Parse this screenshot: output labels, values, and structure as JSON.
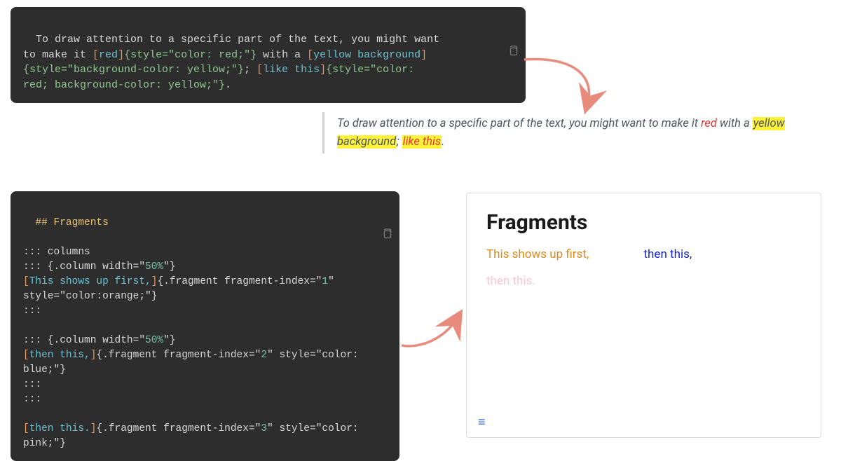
{
  "code1": {
    "p1": "To draw attention to a specific part of the text, you might want ",
    "p2": "to make it ",
    "b1": "[",
    "red": "red",
    "b2": "]",
    "st1": "{style=\"color: red;\"}",
    "p3": " with a ",
    "b3": "[",
    "yellowbg": "yellow background",
    "b4": "]",
    "nl1": "",
    "st2": "{style=\"background-color: yellow;\"}",
    "p4": "; ",
    "b5": "[",
    "like": "like this",
    "b6": "]",
    "st3a": "{style=\"color: ",
    "nl2": "",
    "st3b": "red; background-color: yellow;\"}",
    "p5": "."
  },
  "quote": {
    "p1": "To draw attention to a specific part of the text, you might want to make it ",
    "red": "red",
    "p2": " with a ",
    "ybg": "yellow background",
    "p3": "; ",
    "redybg": "like this",
    "p4": "."
  },
  "code2": {
    "heading": "## Fragments",
    "l1": "::: columns",
    "l2a": "::: {.column width=\"",
    "l2b": "50%",
    "l2c": "\"}",
    "l3a": "[",
    "l3b": "This shows up first,",
    "l3c": "]",
    "l3d": "{.fragment fragment-index=\"",
    "l3e": "1",
    "l3f": "\" ",
    "l4": "style=\"color:orange;\"}",
    "l5": ":::",
    "l7a": "::: {.column width=\"",
    "l7b": "50%",
    "l7c": "\"}",
    "l8a": "[",
    "l8b": "then this,",
    "l8c": "]",
    "l8d": "{.fragment fragment-index=\"",
    "l8e": "2",
    "l8f": "\" style=\"color: ",
    "l9": "blue;\"}",
    "l10": ":::",
    "l11": ":::",
    "l13a": "[",
    "l13b": "then this.",
    "l13c": "]",
    "l13d": "{.fragment fragment-index=\"",
    "l13e": "3",
    "l13f": "\" style=\"color: ",
    "l14": "pink;\"}"
  },
  "slide": {
    "title": "Fragments",
    "col1": "This shows up first,",
    "col2": "then this,",
    "frag3": "then this.",
    "menu_glyph": "≡"
  },
  "colors": {
    "arrow": "#e88a7c"
  }
}
